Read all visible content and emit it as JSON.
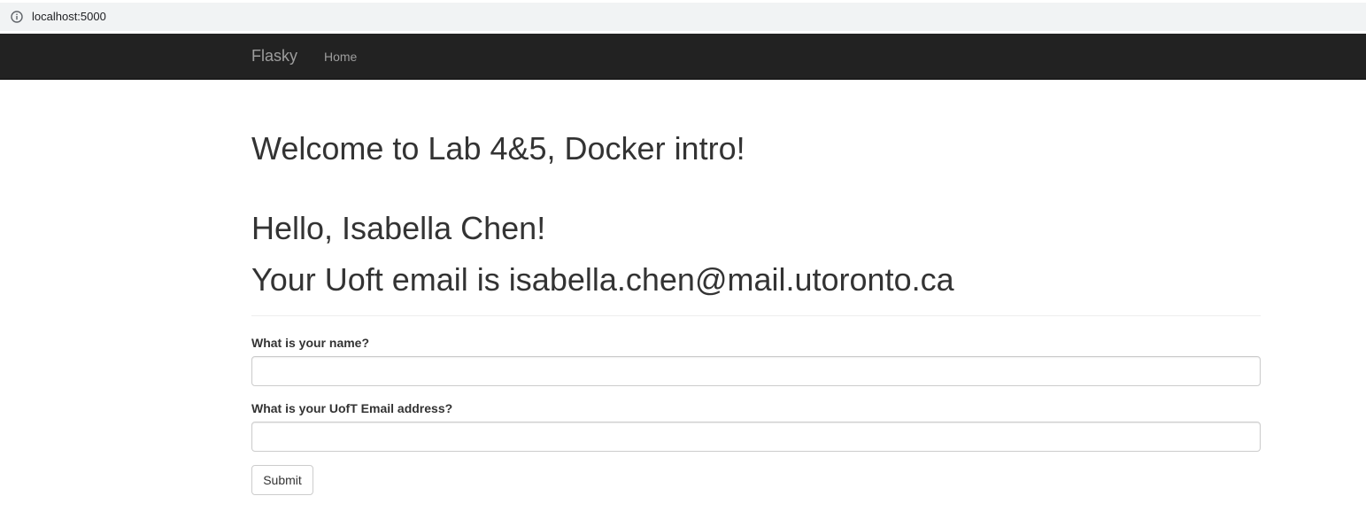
{
  "browser": {
    "url": "localhost:5000",
    "info_icon": "info-circle-icon"
  },
  "navbar": {
    "brand": "Flasky",
    "items": [
      {
        "label": "Home"
      }
    ],
    "background": "#222222",
    "text_color": "#9d9d9d"
  },
  "main": {
    "welcome": "Welcome to Lab 4&5, Docker intro!",
    "greeting": "Hello, Isabella Chen!",
    "email_message": "Your Uoft email is isabella.chen@mail.utoronto.ca"
  },
  "form": {
    "name_label": "What is your name?",
    "name_value": "",
    "email_label": "What is your UofT Email address?",
    "email_value": "",
    "submit_label": "Submit"
  }
}
